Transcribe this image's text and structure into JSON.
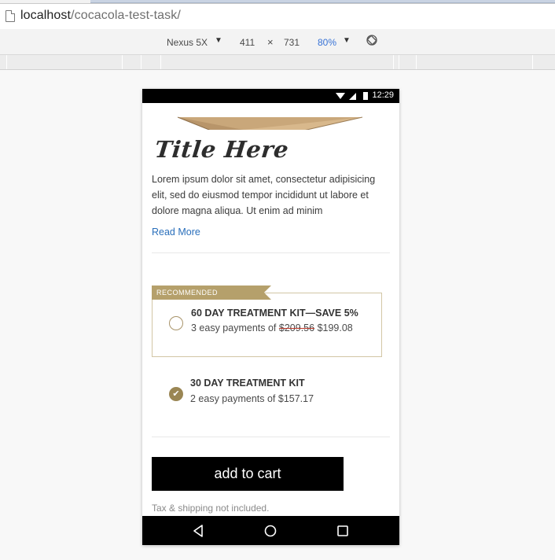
{
  "browser": {
    "url_host": "localhost",
    "url_path": "/cocacola-test-task/"
  },
  "device_toolbar": {
    "device": "Nexus 5X",
    "width": "411",
    "times": "×",
    "height": "731",
    "zoom": "80%",
    "caret": "▼"
  },
  "status_bar": {
    "time": "12:29"
  },
  "product": {
    "title": "Title Here",
    "description": "Lorem ipsum dolor sit amet, consectetur adipisicing elit, sed do eiusmod tempor incididunt ut labore et dolore magna aliqua. Ut enim ad minim",
    "read_more": "Read More"
  },
  "offers": {
    "ribbon": "RECOMMENDED",
    "option1": {
      "title": "60 DAY TREATMENT KIT—SAVE 5%",
      "sub_prefix": "3 easy payments of",
      "old_price": "$209.56",
      "new_price": "$199.08",
      "selected": false
    },
    "option2": {
      "title": "30 DAY TREATMENT KIT",
      "sub": "2 easy payments of $157.17",
      "selected": true,
      "check": "✔"
    }
  },
  "cart": {
    "button": "add to cart",
    "tax_note": "Tax & shipping not included."
  },
  "colors": {
    "accent_gold": "#b5a06b",
    "link_blue": "#2a6fbb",
    "button_black": "#000000"
  }
}
